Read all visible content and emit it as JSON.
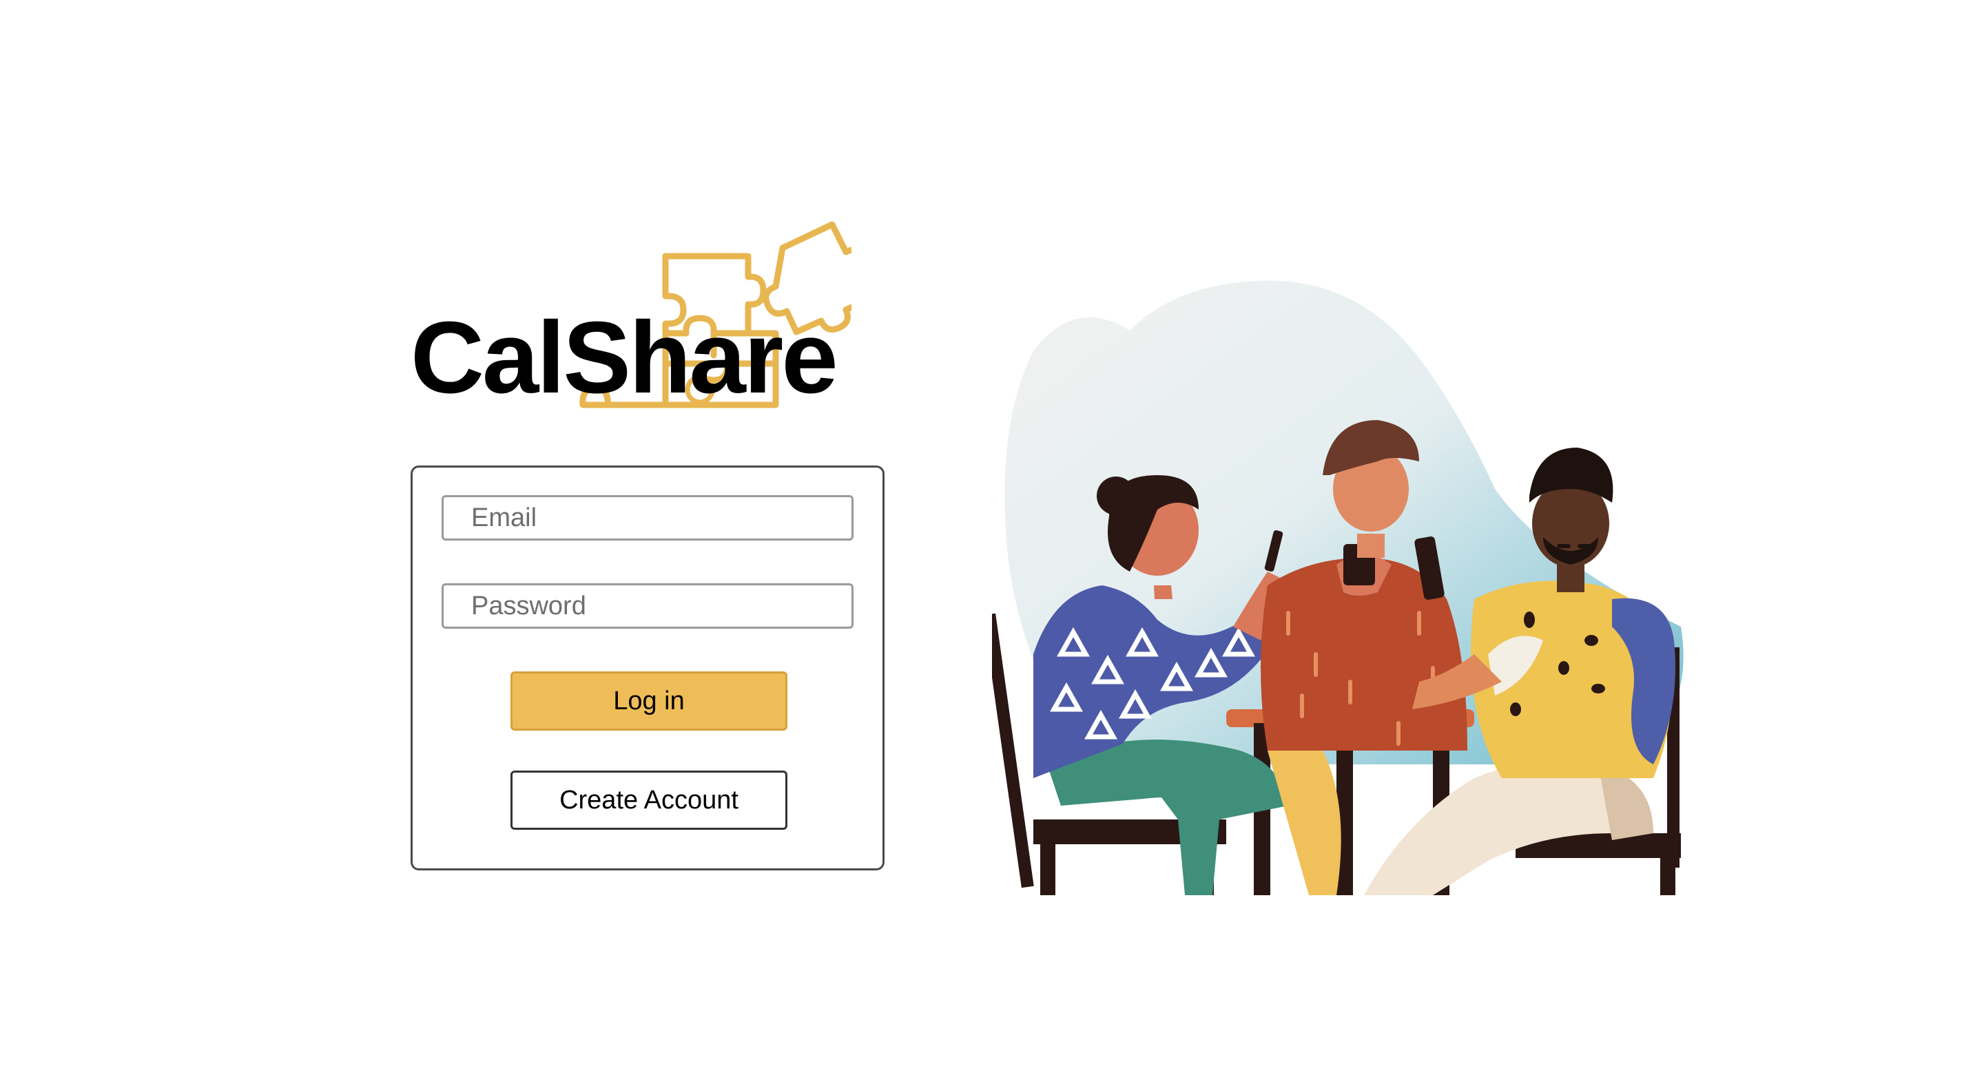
{
  "app": {
    "name": "CalShare"
  },
  "login": {
    "email_placeholder": "Email",
    "password_placeholder": "Password",
    "login_label": "Log in",
    "create_account_label": "Create Account"
  },
  "colors": {
    "accent": "#efbd57",
    "logo_outline": "#e8b650",
    "text": "#000000"
  },
  "illustration": {
    "icon": "people-at-cafe-illustration"
  }
}
